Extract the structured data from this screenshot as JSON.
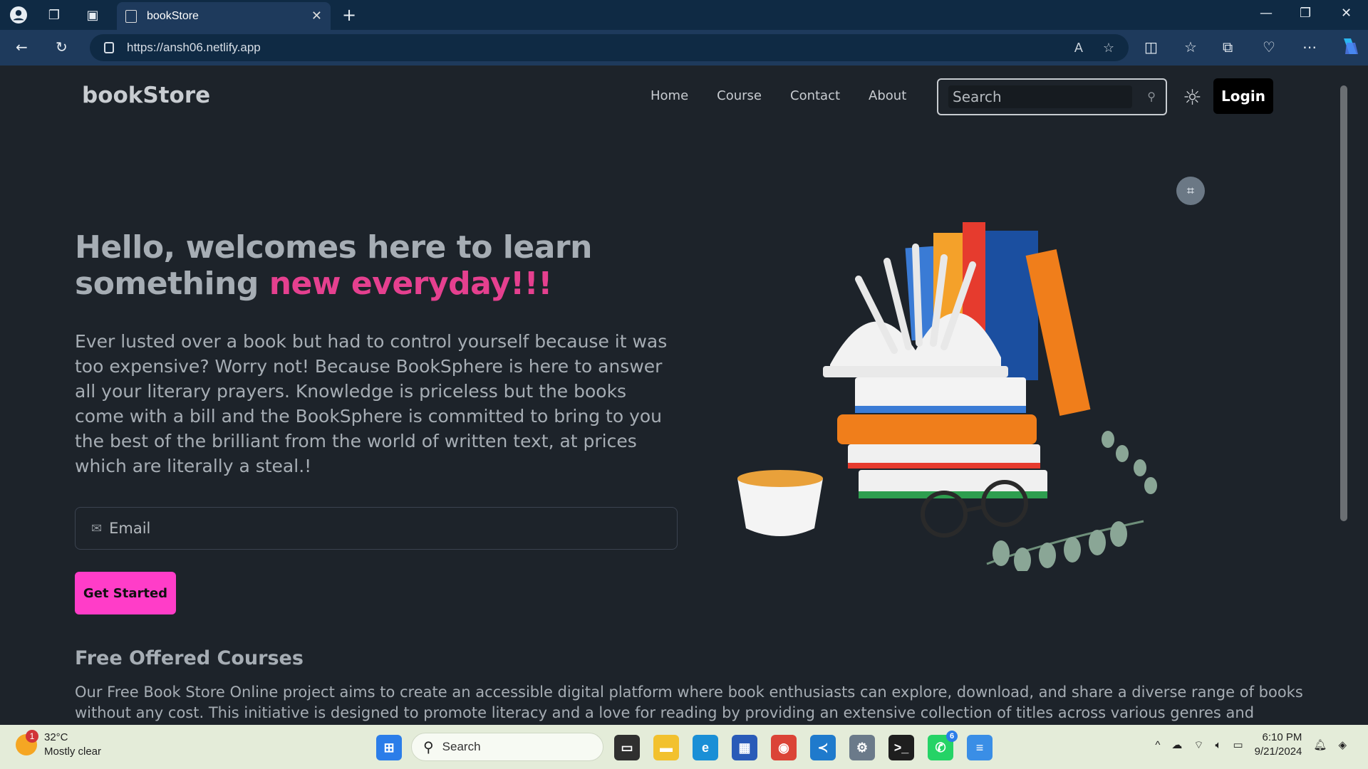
{
  "browser": {
    "tab_title": "bookStore",
    "url": "https://ansh06.netlify.app",
    "new_tab_symbol": "+",
    "close_symbol": "✕"
  },
  "site": {
    "logo": "bookStore",
    "nav": [
      "Home",
      "Course",
      "Contact",
      "About"
    ],
    "search_placeholder": "Search",
    "login_label": "Login",
    "hero": {
      "title_main": "Hello, welcomes here to learn something ",
      "title_highlight": "new everyday!!!",
      "paragraph": "Ever lusted over a book but had to control yourself because it was too expensive? Worry not! Because BookSphere is here to answer all your literary prayers. Knowledge is priceless but the books come with a bill and the BookSphere is committed to bring to you the best of the brilliant from the world of written text, at prices which are literally a steal.!",
      "email_placeholder": "Email",
      "cta_label": "Get Started"
    },
    "courses": {
      "title": "Free Offered Courses",
      "text": "Our Free Book Store Online project aims to create an accessible digital platform where book enthusiasts can explore, download, and share a diverse range of books without any cost. This initiative is designed to promote literacy and a love for reading by providing an extensive collection of titles across various genres and categories."
    }
  },
  "taskbar": {
    "weather_temp": "32°C",
    "weather_desc": "Mostly clear",
    "weather_badge": "1",
    "search_label": "Search",
    "whatsapp_badge": "6",
    "time": "6:10 PM",
    "date": "9/21/2024"
  },
  "colors": {
    "accent_pink": "#e5408f",
    "cta": "#ff3dc8",
    "page_bg": "#1d232a"
  }
}
